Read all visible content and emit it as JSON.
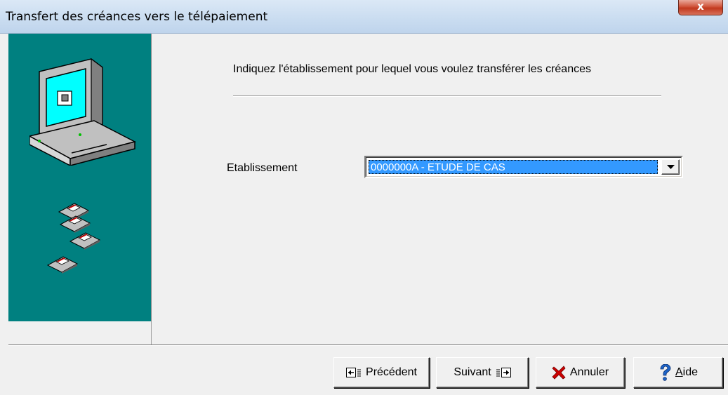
{
  "window": {
    "title": "Transfert des créances vers le télépaiement",
    "close_label": "x"
  },
  "main": {
    "instruction": "Indiquez l'établissement pour lequel vous voulez transférer les créances",
    "establishment_label": "Etablissement",
    "establishment_value": "0000000A - ETUDE DE CAS"
  },
  "buttons": {
    "previous": "Précédent",
    "next": "Suivant",
    "cancel": "Annuler",
    "help_prefix": "A",
    "help_rest": "ide"
  },
  "icons": {
    "computer": "computer-icon",
    "disks": "floppy-disk-icon",
    "previous": "previous-page-icon",
    "next": "next-page-icon",
    "cancel": "red-x-icon",
    "help": "question-mark-icon",
    "dropdown": "chevron-down-icon"
  },
  "colors": {
    "side_panel": "#008080",
    "selection": "#3399ff",
    "cancel_icon": "#cc0000",
    "help_icon": "#1e64c8"
  }
}
